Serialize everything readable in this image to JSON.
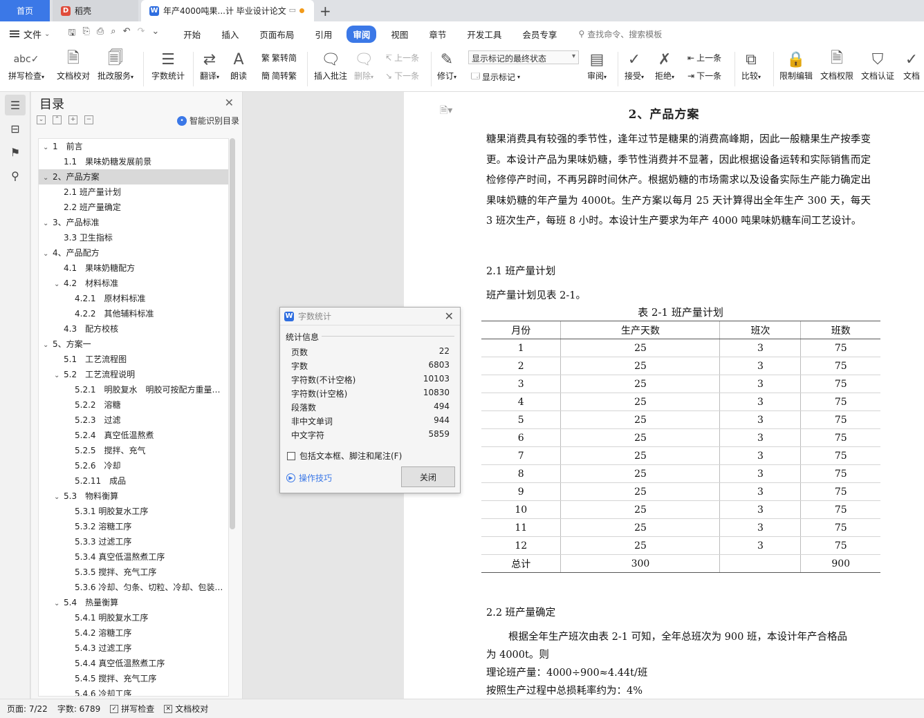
{
  "tabs": {
    "home": "首页",
    "daoke": "稻壳",
    "doc": "年产4000吨果...计 毕业设计论文"
  },
  "menu": {
    "file": "文件",
    "tabs": [
      "开始",
      "插入",
      "页面布局",
      "引用",
      "审阅",
      "视图",
      "章节",
      "开发工具",
      "会员专享"
    ],
    "active": "审阅",
    "search": "查找命令、搜索模板"
  },
  "ribbon": {
    "spell": "拼写检查",
    "check": "文档校对",
    "annotate_service": "批改服务",
    "wordcount": "字数统计",
    "translate": "翻译",
    "read": "朗读",
    "trad": "繁转简",
    "simp": "简转繁",
    "insert_comment": "插入批注",
    "delete": "删除",
    "prev": "上一条",
    "next": "下一条",
    "revise": "修订",
    "show_markup_dd": "显示标记的最终状态",
    "show_markup": "显示标记",
    "review": "审阅",
    "accept": "接受",
    "reject": "拒绝",
    "prev2": "上一条",
    "next2": "下一条",
    "compare": "比较",
    "restrict": "限制编辑",
    "permission": "文档权限",
    "cert": "文档认证",
    "last": "文档"
  },
  "toc": {
    "title": "目录",
    "smart": "智能识别目录",
    "items": [
      {
        "t": "1　前言",
        "l": 0,
        "c": "v"
      },
      {
        "t": "1.1　果味奶糖发展前景",
        "l": 1
      },
      {
        "t": "2、产品方案",
        "l": 0,
        "c": "v",
        "sel": true
      },
      {
        "t": "2.1 班产量计划",
        "l": 1
      },
      {
        "t": "2.2 班产量确定",
        "l": 1
      },
      {
        "t": "3、产品标准",
        "l": 0,
        "c": "v"
      },
      {
        "t": "3.3 卫生指标",
        "l": 1
      },
      {
        "t": "4、产品配方",
        "l": 0,
        "c": "v"
      },
      {
        "t": "4.1　果味奶糖配方",
        "l": 1
      },
      {
        "t": "4.2　材料标准",
        "l": 1,
        "c": "v"
      },
      {
        "t": "4.2.1　原材料标准",
        "l": 2
      },
      {
        "t": "4.2.2　其他辅料标准",
        "l": 2
      },
      {
        "t": "4.3　配方校核",
        "l": 1
      },
      {
        "t": "5、方案一",
        "l": 0,
        "c": "v"
      },
      {
        "t": "5.1　工艺流程图",
        "l": 1
      },
      {
        "t": "5.2　工艺流程说明",
        "l": 1,
        "c": "v"
      },
      {
        "t": "5.2.1　明胶复水　明胶可按配方重量…",
        "l": 2
      },
      {
        "t": "5.2.2　溶糖",
        "l": 2
      },
      {
        "t": "5.2.3　过滤",
        "l": 2
      },
      {
        "t": "5.2.4　真空低温熬煮",
        "l": 2
      },
      {
        "t": "5.2.5　搅拌、充气",
        "l": 2
      },
      {
        "t": "5.2.6　冷却",
        "l": 2
      },
      {
        "t": "5.2.11　成品",
        "l": 2
      },
      {
        "t": "5.3　物料衡算",
        "l": 1,
        "c": "v"
      },
      {
        "t": "5.3.1 明胶复水工序",
        "l": 2
      },
      {
        "t": "5.3.2 溶糖工序",
        "l": 2
      },
      {
        "t": "5.3.3 过滤工序",
        "l": 2
      },
      {
        "t": "5.3.4 真空低温熬煮工序",
        "l": 2
      },
      {
        "t": "5.3.5 搅拌、充气工序",
        "l": 2
      },
      {
        "t": "5.3.6 冷却、匀条、切粒、冷却、包装…",
        "l": 2
      },
      {
        "t": "5.4　热量衡算",
        "l": 1,
        "c": "v"
      },
      {
        "t": "5.4.1 明胶复水工序",
        "l": 2
      },
      {
        "t": "5.4.2 溶糖工序",
        "l": 2
      },
      {
        "t": "5.4.3 过滤工序",
        "l": 2
      },
      {
        "t": "5.4.4 真空低温熬煮工序",
        "l": 2
      },
      {
        "t": "5.4.5 搅拌、充气工序",
        "l": 2
      },
      {
        "t": "5.4.6 冷却工序",
        "l": 2
      }
    ]
  },
  "doc": {
    "heading": "2、产品方案",
    "p1": "糖果消费具有较强的季节性，逢年过节是糖果的消费高峰期，因此一般糖果生产按季变更。本设计产品为果味奶糖，季节性消费并不显著，因此根据设备运转和实际销售而定检修停产时间，不再另辟时间休产。根据奶糖的市场需求以及设备实际生产能力确定出果味奶糖的年产量为 4000t。生产方案以每月 25 天计算得出全年生产 300 天，每天 3 班次生产，每班 8 小时。本设计生产要求为年产 4000 吨果味奶糖车间工艺设计。",
    "s21": "2.1 班产量计划",
    "s21_text": "班产量计划见表 2-1。",
    "caption": "表 2-1 班产量计划",
    "table": {
      "headers": [
        "月份",
        "生产天数",
        "班次",
        "班数"
      ],
      "rows": [
        [
          "1",
          "25",
          "3",
          "75"
        ],
        [
          "2",
          "25",
          "3",
          "75"
        ],
        [
          "3",
          "25",
          "3",
          "75"
        ],
        [
          "4",
          "25",
          "3",
          "75"
        ],
        [
          "5",
          "25",
          "3",
          "75"
        ],
        [
          "6",
          "25",
          "3",
          "75"
        ],
        [
          "7",
          "25",
          "3",
          "75"
        ],
        [
          "8",
          "25",
          "3",
          "75"
        ],
        [
          "9",
          "25",
          "3",
          "75"
        ],
        [
          "10",
          "25",
          "3",
          "75"
        ],
        [
          "11",
          "25",
          "3",
          "75"
        ],
        [
          "12",
          "25",
          "3",
          "75"
        ]
      ],
      "total": [
        "总计",
        "300",
        "",
        "900"
      ]
    },
    "s22": "2.2 班产量确定",
    "p2a": "根据全年生产班次由表 2-1 可知，全年总班次为 900 班，本设计年产合格品",
    "p2b": "为 4000t。则",
    "p3": "理论班产量：4000÷900≈4.44t/班",
    "p4": "按照生产过程中总损耗率约为：4%"
  },
  "dialog": {
    "title": "字数统计",
    "section": "统计信息",
    "rows": [
      [
        "页数",
        "22"
      ],
      [
        "字数",
        "6803"
      ],
      [
        "字符数(不计空格)",
        "10103"
      ],
      [
        "字符数(计空格)",
        "10830"
      ],
      [
        "段落数",
        "494"
      ],
      [
        "非中文单词",
        "944"
      ],
      [
        "中文字符",
        "5859"
      ]
    ],
    "checkbox": "包括文本框、脚注和尾注(F)",
    "tip": "操作技巧",
    "close": "关闭"
  },
  "status": {
    "page": "页面: 7/22",
    "words": "字数: 6789",
    "spell": "拼写检查",
    "proof": "文档校对"
  }
}
